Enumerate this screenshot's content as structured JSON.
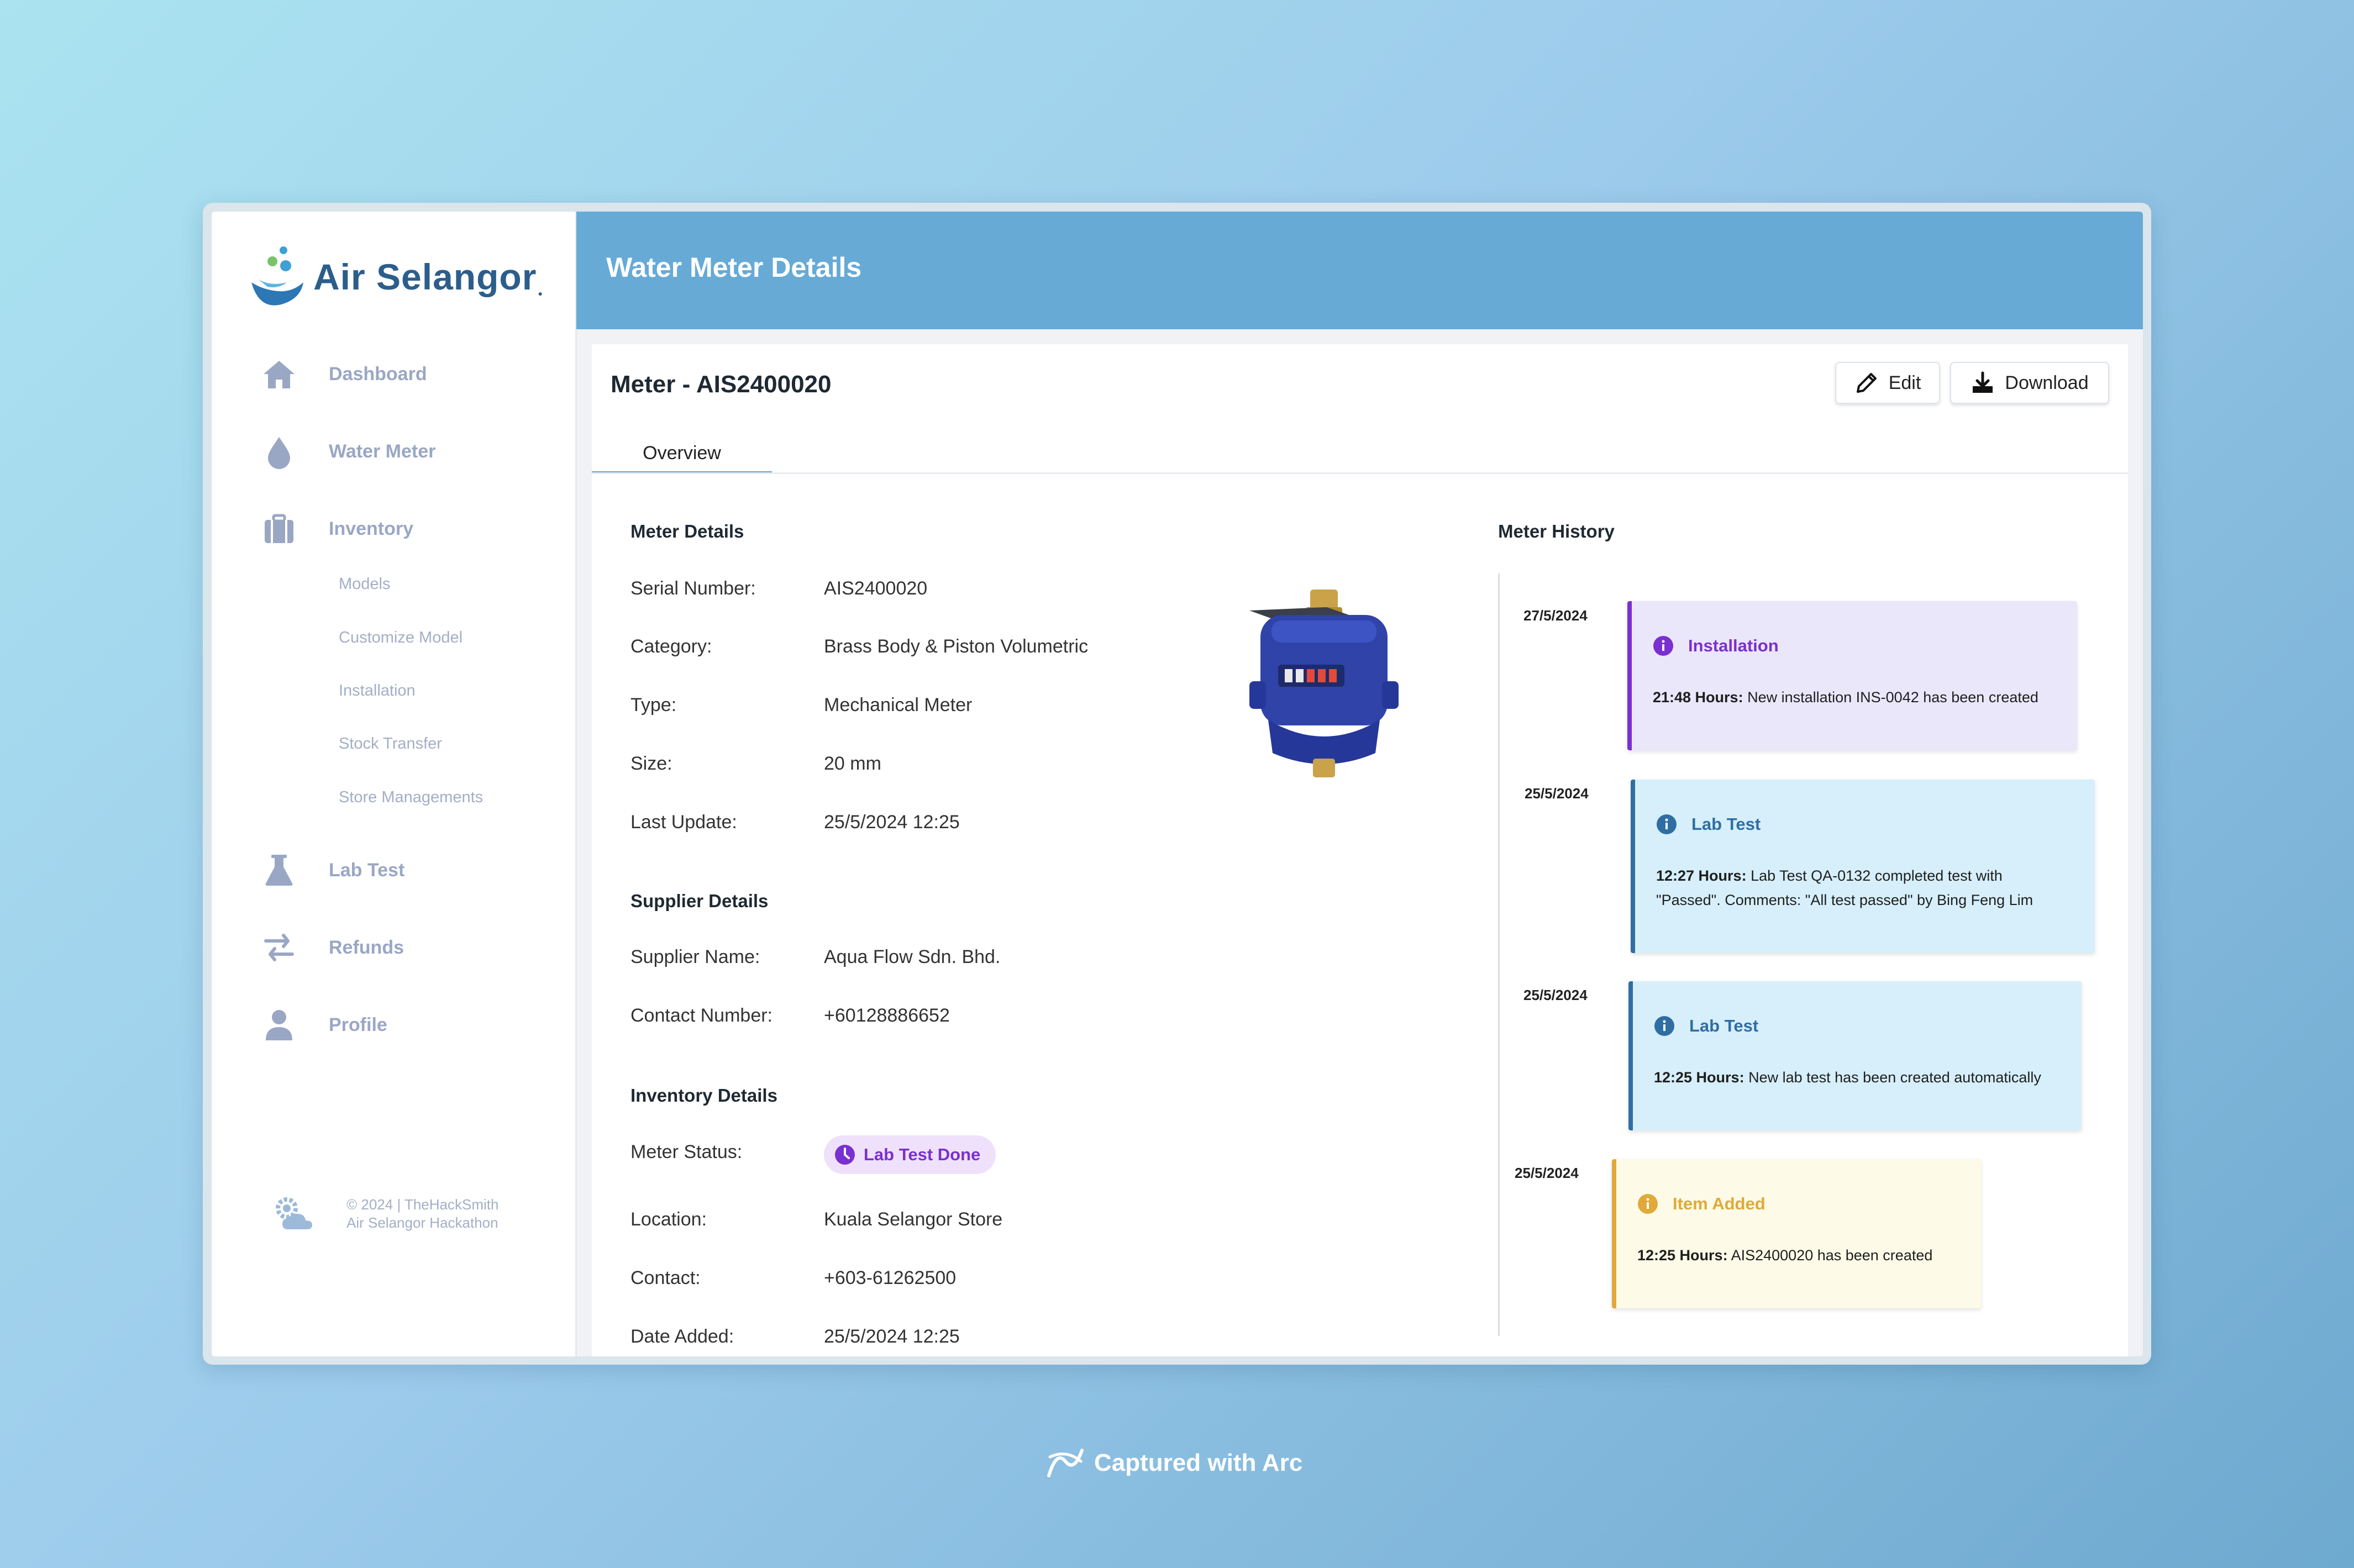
{
  "app": {
    "brand": "Air Selangor",
    "page_title": "Water Meter Details"
  },
  "sidebar": {
    "items": [
      {
        "label": "Dashboard",
        "icon": "home-icon"
      },
      {
        "label": "Water Meter",
        "icon": "water-drop-icon"
      },
      {
        "label": "Inventory",
        "icon": "briefcase-icon"
      },
      {
        "label": "Lab Test",
        "icon": "flask-icon"
      },
      {
        "label": "Refunds",
        "icon": "swap-arrows-icon"
      },
      {
        "label": "Profile",
        "icon": "user-icon"
      }
    ],
    "inventory_sub": [
      "Models",
      "Customize Model",
      "Installation",
      "Stock Transfer",
      "Store Managements"
    ],
    "footer": {
      "line1": "© 2024 | TheHackSmith",
      "line2": "Air Selangor Hackathon"
    }
  },
  "meter": {
    "title": "Meter - AIS2400020",
    "edit_label": "Edit",
    "download_label": "Download",
    "tab": "Overview"
  },
  "details": {
    "title": "Meter Details",
    "rows": [
      {
        "label": "Serial Number:",
        "value": "AIS2400020"
      },
      {
        "label": "Category:",
        "value": "Brass Body & Piston Volumetric"
      },
      {
        "label": "Type:",
        "value": "Mechanical Meter"
      },
      {
        "label": "Size:",
        "value": "20 mm"
      },
      {
        "label": "Last Update:",
        "value": "25/5/2024 12:25"
      }
    ]
  },
  "supplier": {
    "title": "Supplier Details",
    "rows": [
      {
        "label": "Supplier Name:",
        "value": "Aqua Flow Sdn. Bhd."
      },
      {
        "label": "Contact Number:",
        "value": "+60128886652"
      }
    ]
  },
  "inventory": {
    "title": "Inventory Details",
    "status_label": "Meter Status:",
    "status_value": "Lab Test Done",
    "rows": [
      {
        "label": "Location:",
        "value": "Kuala Selangor Store"
      },
      {
        "label": "Contact:",
        "value": "+603-61262500"
      },
      {
        "label": "Date Added:",
        "value": "25/5/2024 12:25"
      }
    ]
  },
  "history": {
    "title": "Meter History",
    "entries": [
      {
        "date": "27/5/2024",
        "title": "Installation",
        "time": "21:48 Hours:",
        "text": " New installation INS-0042 has been created",
        "color": "#7b2fd0",
        "bg": "#ebe7fb"
      },
      {
        "date": "25/5/2024",
        "title": "Lab Test",
        "time": "12:27 Hours:",
        "text": " Lab Test QA-0132 completed test with",
        "text2": "\"Passed\". Comments: \"All test passed\" by Bing Feng Lim",
        "color": "#2f6ea3",
        "bg": "#d6effb"
      },
      {
        "date": "25/5/2024",
        "title": "Lab Test",
        "time": "12:25 Hours:",
        "text": " New lab test has been created automatically",
        "color": "#2f6ea3",
        "bg": "#d6effb"
      },
      {
        "date": "25/5/2024",
        "title": "Item Added",
        "time": "12:25 Hours:",
        "text": " AIS2400020 has been created",
        "color": "#e0a93a",
        "bg": "#fdfbe7"
      }
    ]
  },
  "capture": {
    "label": "Captured with Arc"
  }
}
